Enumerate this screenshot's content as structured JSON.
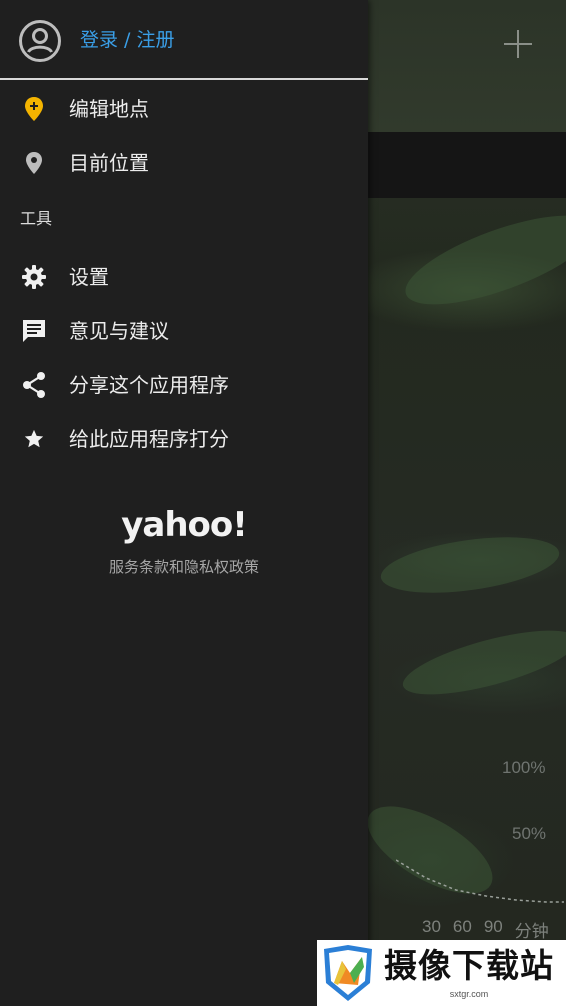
{
  "drawer": {
    "login_label": "登录 / 注册",
    "items": [
      {
        "label": "编辑地点",
        "icon": "location-pin-add-icon",
        "icon_color": "#f4b400"
      },
      {
        "label": "目前位置",
        "icon": "location-pin-icon",
        "icon_color": "#bdbdbd"
      }
    ],
    "tools_section": {
      "title": "工具",
      "items": [
        {
          "label": "设置",
          "icon": "gear-icon"
        },
        {
          "label": "意见与建议",
          "icon": "feedback-icon"
        },
        {
          "label": "分享这个应用程序",
          "icon": "share-icon"
        },
        {
          "label": "给此应用程序打分",
          "icon": "star-icon"
        }
      ]
    },
    "brand": "yahoo!",
    "terms_label": "服务条款和隐私权政策"
  },
  "background": {
    "chart_labels": {
      "pct_100": "100%",
      "pct_50": "50%",
      "x_ticks": [
        "30",
        "60",
        "90"
      ],
      "x_unit": "分钟"
    }
  },
  "watermark": {
    "text": "摄像下载站",
    "url": "sxtgr.com"
  },
  "colors": {
    "accent": "#3a9fe8",
    "drawer_bg": "#1f1f1f",
    "pin_yellow": "#f4b400"
  }
}
